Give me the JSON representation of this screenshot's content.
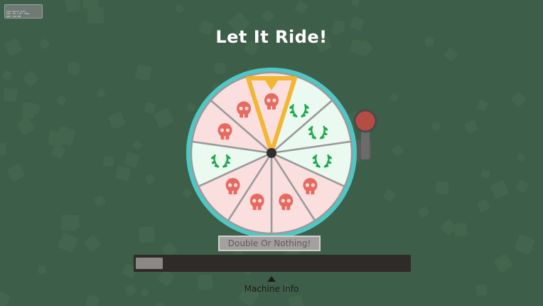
{
  "screen": {
    "title": "Let It Ride!",
    "background_color": "#3d5e48"
  },
  "debug_overlay": {
    "text": "Test Build Info\nFPS: 60 | DT: 16ms\nMEM: 214 MB\nDraw calls: 48\nRES: 764x430",
    "lines": [
      "Test Build Info",
      "FPS: 60 | DT: 16ms",
      "MEM: 214 MB",
      "Draw calls: 48",
      "RES: 764x430"
    ]
  },
  "wheel": {
    "rim_color": "#4ec7c5",
    "pointer_color": "#f2b632",
    "hub_color": "#2f2f2f",
    "lever_knob_color": "#b44d44",
    "segments": [
      {
        "type": "skull",
        "color": "#fbdede",
        "icon": "skull-icon"
      },
      {
        "type": "wreath",
        "color": "#eafaf0",
        "icon": "laurel-wreath-icon"
      },
      {
        "type": "wreath",
        "color": "#eafaf0",
        "icon": "laurel-wreath-icon"
      },
      {
        "type": "wreath",
        "color": "#eafaf0",
        "icon": "laurel-wreath-icon"
      },
      {
        "type": "skull",
        "color": "#fbdede",
        "icon": "skull-icon"
      },
      {
        "type": "skull",
        "color": "#fbdede",
        "icon": "skull-icon"
      },
      {
        "type": "skull",
        "color": "#fbdede",
        "icon": "skull-icon"
      },
      {
        "type": "skull",
        "color": "#fbdede",
        "icon": "skull-icon"
      },
      {
        "type": "wreath",
        "color": "#eafaf0",
        "icon": "laurel-wreath-icon"
      },
      {
        "type": "skull",
        "color": "#fbdede",
        "icon": "skull-icon"
      },
      {
        "type": "skull",
        "color": "#fbdede",
        "icon": "skull-icon"
      }
    ]
  },
  "double_or_nothing": {
    "label": "Double Or Nothing!"
  },
  "progress": {
    "fraction": 0.1
  },
  "machine_info": {
    "label": "Machine Info",
    "arrow_icon": "triangle-up-icon"
  }
}
